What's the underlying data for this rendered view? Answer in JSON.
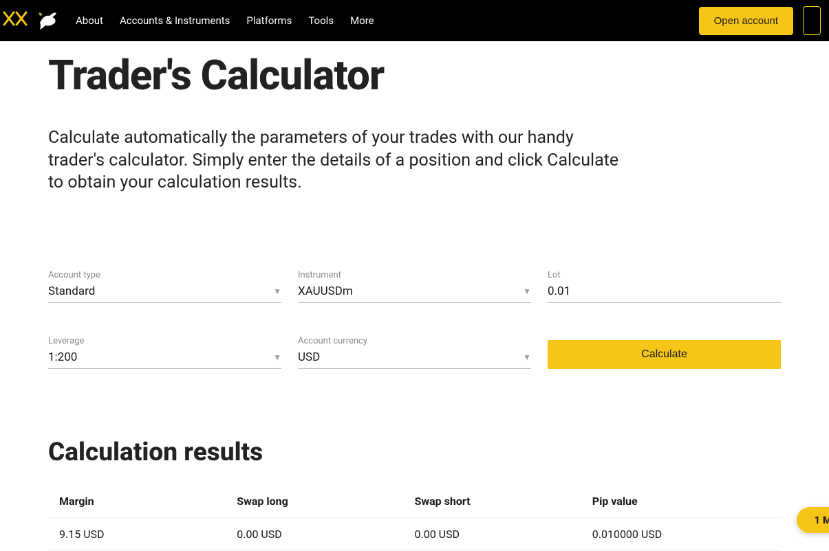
{
  "header": {
    "nav": [
      "About",
      "Accounts & Instruments",
      "Platforms",
      "Tools",
      "More"
    ],
    "open_account": "Open account"
  },
  "page": {
    "title": "Trader's Calculator",
    "intro": "Calculate automatically the parameters of your trades with our handy trader's calculator. Simply enter the details of a position and click Calculate to obtain your calculation results."
  },
  "form": {
    "account_type": {
      "label": "Account type",
      "value": "Standard"
    },
    "instrument": {
      "label": "Instrument",
      "value": "XAUUSDm"
    },
    "lot": {
      "label": "Lot",
      "value": "0.01"
    },
    "leverage": {
      "label": "Leverage",
      "value": "1:200"
    },
    "account_currency": {
      "label": "Account currency",
      "value": "USD"
    },
    "calculate_label": "Calculate"
  },
  "results": {
    "title": "Calculation results",
    "columns": [
      "Margin",
      "Swap long",
      "Swap short",
      "Pip value"
    ],
    "values": [
      "9.15 USD",
      "0.00 USD",
      "0.00 USD",
      "0.010000 USD"
    ]
  },
  "floating": {
    "text": "1 M"
  }
}
